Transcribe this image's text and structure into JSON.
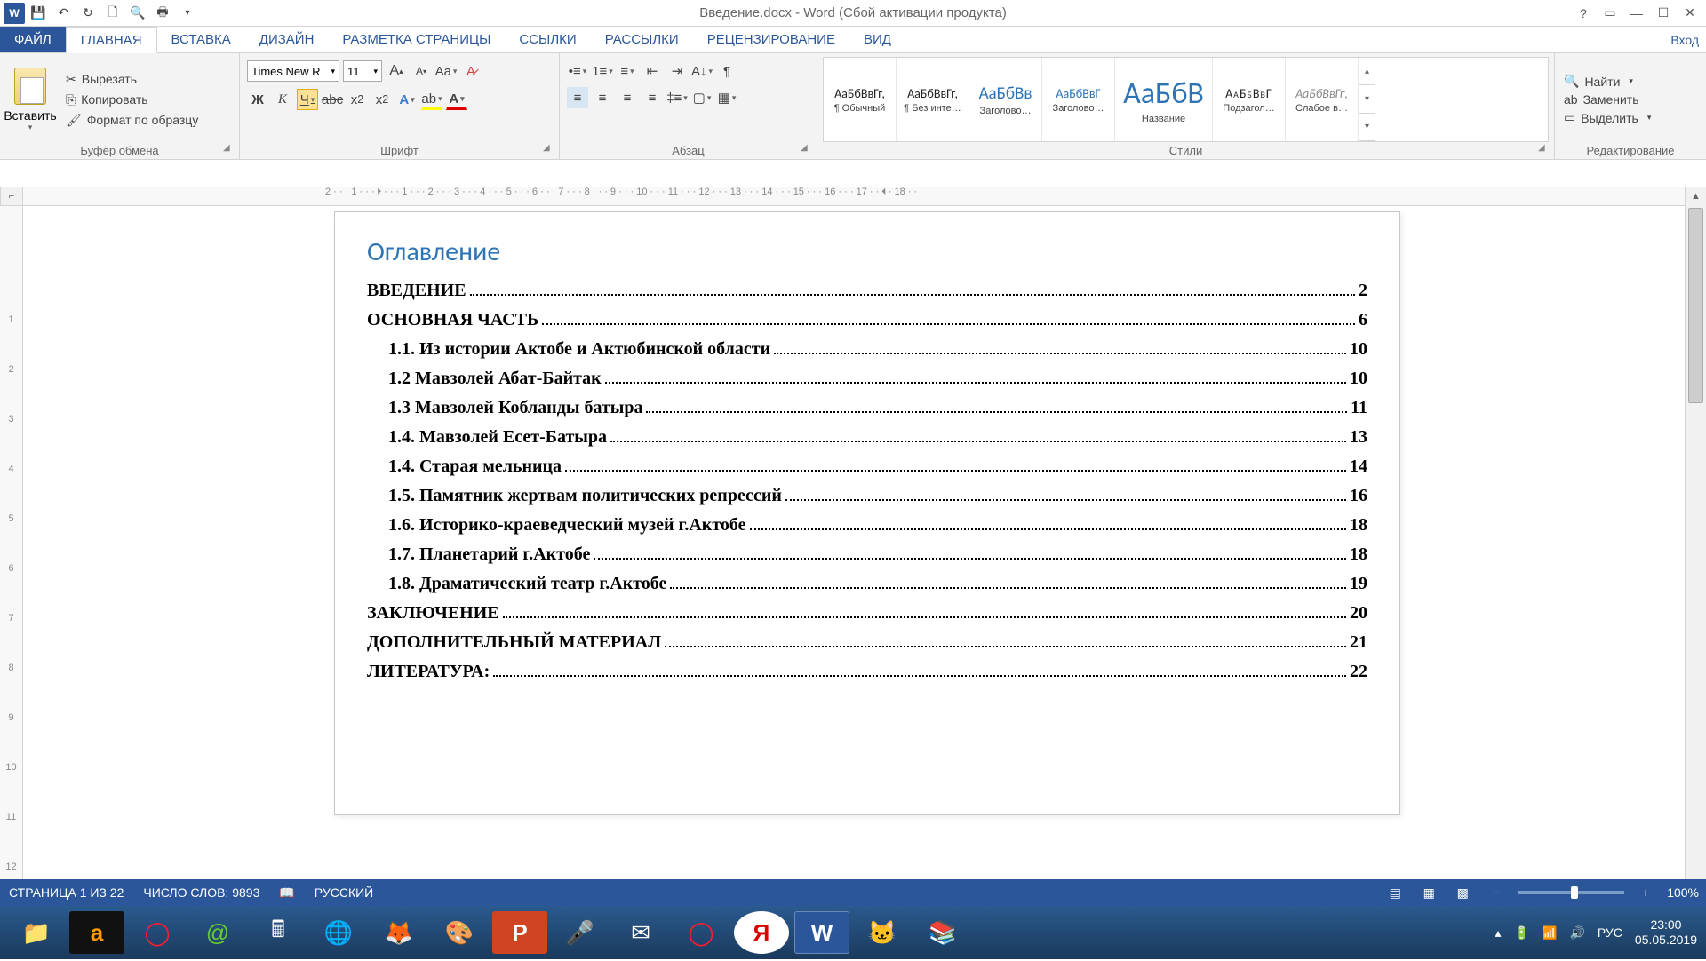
{
  "title": "Введение.docx - Word (Сбой активации продукта)",
  "tabs": {
    "file": "ФАЙЛ",
    "items": [
      "ГЛАВНАЯ",
      "ВСТАВКА",
      "ДИЗАЙН",
      "РАЗМЕТКА СТРАНИЦЫ",
      "ССЫЛКИ",
      "РАССЫЛКИ",
      "РЕЦЕНЗИРОВАНИЕ",
      "ВИД"
    ],
    "signin": "Вход"
  },
  "clipboard": {
    "paste": "Вставить",
    "cut": "Вырезать",
    "copy": "Копировать",
    "formatpainter": "Формат по образцу",
    "group": "Буфер обмена"
  },
  "font": {
    "name": "Times New R",
    "size": "11",
    "group": "Шрифт",
    "bold": "Ж",
    "italic": "К",
    "underline": "Ч"
  },
  "paragraph": {
    "group": "Абзац"
  },
  "styles": {
    "group": "Стили",
    "preview": "АаБбВвГг,",
    "preview2": "АаБбВв",
    "preview3": "АаБбВвГ",
    "preview4": "АаБбВ",
    "items": [
      "¶ Обычный",
      "¶ Без инте…",
      "Заголово…",
      "Заголово…",
      "Название",
      "Подзагол…",
      "Слабое в…"
    ]
  },
  "editing": {
    "find": "Найти",
    "replace": "Заменить",
    "select": "Выделить",
    "group": "Редактирование"
  },
  "ruler": {
    "h": "2 · · · 1 · · · 🞂 · · · 1 · · · 2 · · · 3 · · · 4 · · · 5 · · · 6 · · · 7 · · · 8 · · · 9 · · · 10 · · · 11 · · · 12 · · · 13 · · · 14 · · · 15 · · · 16 · · · 17 · · 🞀 · 18 · ·"
  },
  "doc": {
    "heading": "Оглавление",
    "toc": [
      {
        "t": "ВВЕДЕНИЕ",
        "p": "2",
        "sub": false
      },
      {
        "t": "ОСНОВНАЯ ЧАСТЬ",
        "p": "6",
        "sub": false
      },
      {
        "t": "1.1. Из истории Актобе и Актюбинской области",
        "p": "10",
        "sub": true
      },
      {
        "t": "1.2 Мавзолей Абат-Байтак",
        "p": "10",
        "sub": true
      },
      {
        "t": "1.3 Мавзолей Кобланды батыра",
        "p": "11",
        "sub": true
      },
      {
        "t": "1.4. Мавзолей Есет-Батыра",
        "p": "13",
        "sub": true
      },
      {
        "t": "1.4. Старая мельница",
        "p": "14",
        "sub": true
      },
      {
        "t": "1.5. Памятник жертвам политических репрессий",
        "p": "16",
        "sub": true
      },
      {
        "t": "1.6. Историко-краеведческий музей г.Актобе",
        "p": "18",
        "sub": true
      },
      {
        "t": "1.7. Планетарий г.Актобе",
        "p": "18",
        "sub": true
      },
      {
        "t": "1.8. Драматический театр г.Актобе",
        "p": "19",
        "sub": true
      },
      {
        "t": "ЗАКЛЮЧЕНИЕ",
        "p": "20",
        "sub": false
      },
      {
        "t": "ДОПОЛНИТЕЛЬНЫЙ МАТЕРИАЛ",
        "p": "21",
        "sub": false
      },
      {
        "t": "ЛИТЕРАТУРА:",
        "p": "22",
        "sub": false
      }
    ]
  },
  "status": {
    "page": "СТРАНИЦА 1 ИЗ 22",
    "words": "ЧИСЛО СЛОВ: 9893",
    "lang": "РУССКИЙ",
    "zoom": "100%"
  },
  "tray": {
    "lang": "РУС",
    "time": "23:00",
    "date": "05.05.2019"
  }
}
